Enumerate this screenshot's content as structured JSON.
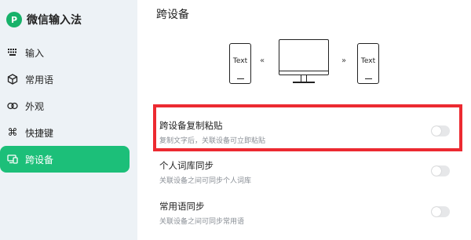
{
  "app": {
    "title": "微信输入法",
    "logo": "P"
  },
  "sidebar": {
    "items": [
      {
        "label": "输入",
        "icon": "keyboard-icon"
      },
      {
        "label": "常用语",
        "icon": "cube-icon"
      },
      {
        "label": "外观",
        "icon": "rings-icon"
      },
      {
        "label": "快捷键",
        "icon": "command-icon"
      },
      {
        "label": "跨设备",
        "icon": "device-icon",
        "active": true
      }
    ]
  },
  "main": {
    "title": "跨设备",
    "illustration": {
      "left_phone_text": "Text",
      "right_phone_text": "Text",
      "left_arrow": "«",
      "right_arrow": "»"
    },
    "settings": [
      {
        "title": "跨设备复制粘贴",
        "description": "复制文字后，关联设备可立即粘贴",
        "enabled": false
      },
      {
        "title": "个人词库同步",
        "description": "关联设备之间可同步个人词库",
        "enabled": false
      },
      {
        "title": "常用语同步",
        "description": "关联设备之间可同步常用语",
        "enabled": false
      }
    ]
  },
  "colors": {
    "accent": "#1cbf79",
    "highlight": "#ec2a31"
  }
}
